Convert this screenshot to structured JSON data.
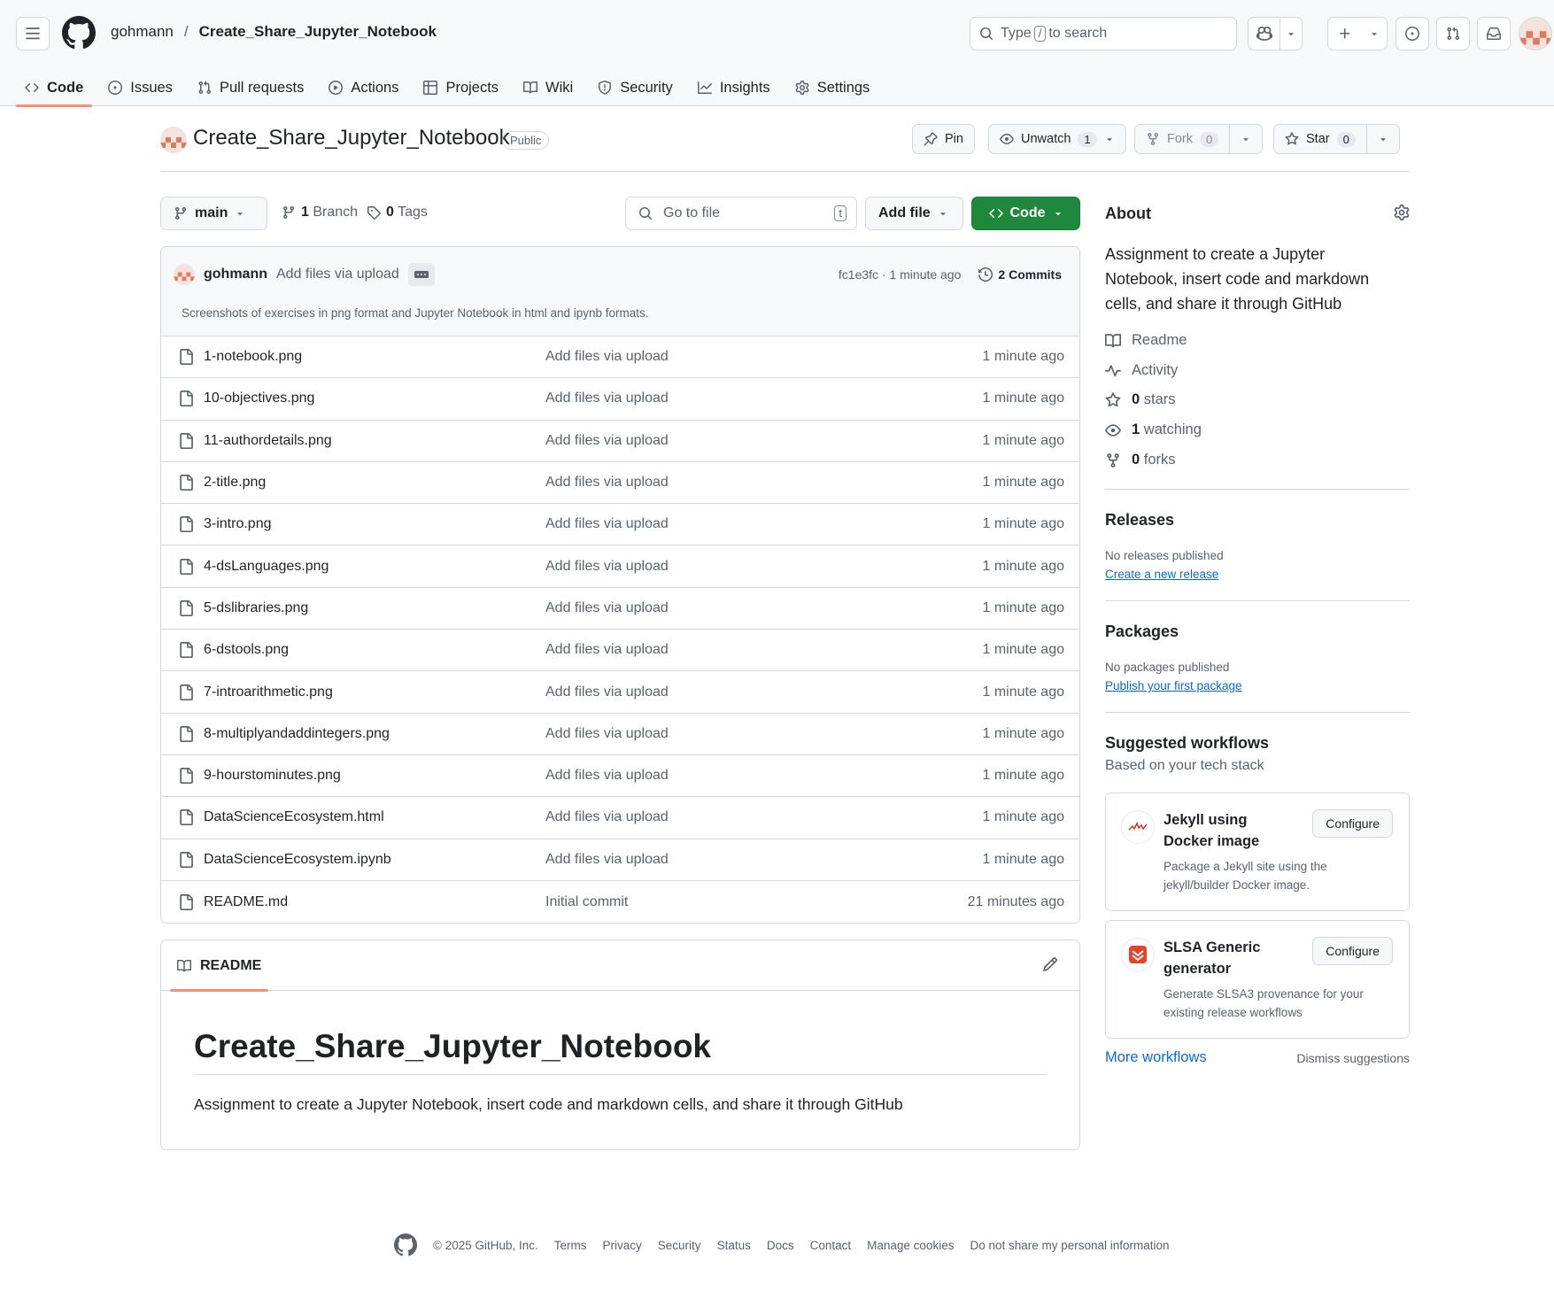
{
  "header": {
    "owner": "gohmann",
    "separator": "/",
    "repo": "Create_Share_Jupyter_Notebook",
    "search_prefix": "Type",
    "search_key": "/",
    "search_suffix": "to search"
  },
  "tabs": [
    {
      "label": "Code",
      "icon": "code-icon"
    },
    {
      "label": "Issues",
      "icon": "issue-icon"
    },
    {
      "label": "Pull requests",
      "icon": "pull-request-icon"
    },
    {
      "label": "Actions",
      "icon": "play-icon"
    },
    {
      "label": "Projects",
      "icon": "table-icon"
    },
    {
      "label": "Wiki",
      "icon": "book-icon"
    },
    {
      "label": "Security",
      "icon": "shield-icon"
    },
    {
      "label": "Insights",
      "icon": "graph-icon"
    },
    {
      "label": "Settings",
      "icon": "gear-icon"
    }
  ],
  "repo": {
    "title": "Create_Share_Jupyter_Notebook",
    "visibility": "Public",
    "pin_label": "Pin",
    "unwatch_label": "Unwatch",
    "watch_count": "1",
    "fork_label": "Fork",
    "fork_count": "0",
    "star_label": "Star",
    "star_count": "0"
  },
  "branch": {
    "name": "main",
    "branch_count": "1",
    "branch_label": "Branch",
    "tag_count": "0",
    "tag_label": "Tags",
    "goto_placeholder": "Go to file",
    "goto_key": "t",
    "add_file_label": "Add file",
    "code_label": "Code"
  },
  "commit": {
    "user": "gohmann",
    "message": "Add files via upload",
    "hash_time": "fc1e3fc · 1 minute ago",
    "commits_label": "2 Commits",
    "description": "Screenshots of exercises in png format and Jupyter Notebook in html and ipynb formats."
  },
  "files": [
    {
      "name": "1-notebook.png",
      "message": "Add files via upload",
      "time": "1 minute ago"
    },
    {
      "name": "10-objectives.png",
      "message": "Add files via upload",
      "time": "1 minute ago"
    },
    {
      "name": "11-authordetails.png",
      "message": "Add files via upload",
      "time": "1 minute ago"
    },
    {
      "name": "2-title.png",
      "message": "Add files via upload",
      "time": "1 minute ago"
    },
    {
      "name": "3-intro.png",
      "message": "Add files via upload",
      "time": "1 minute ago"
    },
    {
      "name": "4-dsLanguages.png",
      "message": "Add files via upload",
      "time": "1 minute ago"
    },
    {
      "name": "5-dslibraries.png",
      "message": "Add files via upload",
      "time": "1 minute ago"
    },
    {
      "name": "6-dstools.png",
      "message": "Add files via upload",
      "time": "1 minute ago"
    },
    {
      "name": "7-introarithmetic.png",
      "message": "Add files via upload",
      "time": "1 minute ago"
    },
    {
      "name": "8-multiplyandaddintegers.png",
      "message": "Add files via upload",
      "time": "1 minute ago"
    },
    {
      "name": "9-hourstominutes.png",
      "message": "Add files via upload",
      "time": "1 minute ago"
    },
    {
      "name": "DataScienceEcosystem.html",
      "message": "Add files via upload",
      "time": "1 minute ago"
    },
    {
      "name": "DataScienceEcosystem.ipynb",
      "message": "Add files via upload",
      "time": "1 minute ago"
    },
    {
      "name": "README.md",
      "message": "Initial commit",
      "time": "21 minutes ago"
    }
  ],
  "readme": {
    "tab_label": "README",
    "heading": "Create_Share_Jupyter_Notebook",
    "body": "Assignment to create a Jupyter Notebook, insert code and markdown cells, and share it through GitHub"
  },
  "about": {
    "title": "About",
    "description": "Assignment to create a Jupyter Notebook, insert code and markdown cells, and share it through GitHub",
    "readme_label": "Readme",
    "activity_label": "Activity",
    "stars_count": "0",
    "stars_label": "stars",
    "watching_count": "1",
    "watching_label": "watching",
    "forks_count": "0",
    "forks_label": "forks"
  },
  "releases": {
    "title": "Releases",
    "empty": "No releases published",
    "link": "Create a new release"
  },
  "packages": {
    "title": "Packages",
    "empty": "No packages published",
    "link": "Publish your first package"
  },
  "workflows": {
    "title": "Suggested workflows",
    "subtitle": "Based on your tech stack",
    "items": [
      {
        "name": "Jekyll using Docker image",
        "description": "Package a Jekyll site using the jekyll/builder Docker image.",
        "button": "Configure"
      },
      {
        "name": "SLSA Generic generator",
        "description": "Generate SLSA3 provenance for your existing release workflows",
        "button": "Configure"
      }
    ],
    "more_label": "More workflows",
    "dismiss_label": "Dismiss suggestions"
  },
  "footer": {
    "copyright": "© 2025 GitHub, Inc.",
    "links": [
      "Terms",
      "Privacy",
      "Security",
      "Status",
      "Docs",
      "Contact",
      "Manage cookies",
      "Do not share my personal information"
    ]
  },
  "colors": {
    "accent_tab": "#fd8c73",
    "primary_button": "#1f883d",
    "link": "#0969da"
  }
}
